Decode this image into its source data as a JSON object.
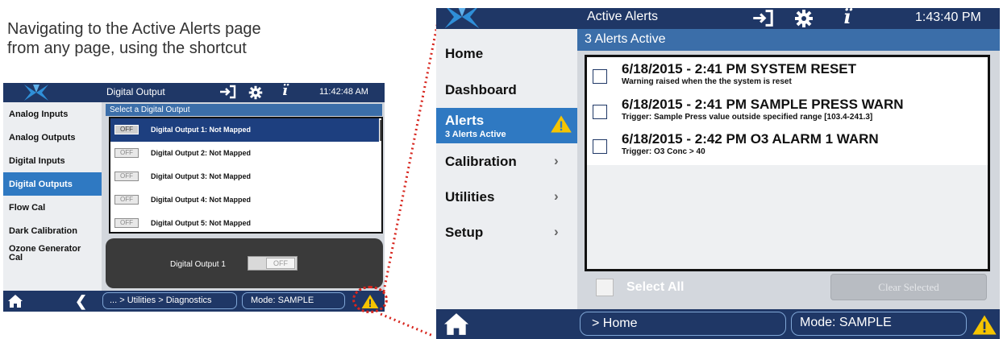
{
  "caption": {
    "line1": "Navigating to the Active Alerts page",
    "line2": "from any page, using the shortcut"
  },
  "colors": {
    "header": "#1f3766",
    "accent": "#2f79c2",
    "warning": "#f5c400",
    "callout": "#d7261e"
  },
  "small_screen": {
    "header": {
      "title": "Digital Output",
      "clock": "11:42:48 AM",
      "icons": [
        "logo-icon",
        "enter-icon",
        "gear-icon",
        "info-icon"
      ]
    },
    "sidebar": [
      {
        "label": "Analog Inputs",
        "active": false
      },
      {
        "label": "Analog Outputs",
        "active": false
      },
      {
        "label": "Digital Inputs",
        "active": false
      },
      {
        "label": "Digital Outputs",
        "active": true
      },
      {
        "label": "Flow Cal",
        "active": false
      },
      {
        "label": "Dark Calibration",
        "active": false
      },
      {
        "label": "Ozone Generator Cal",
        "active": false
      }
    ],
    "subheader": "Select a Digital Output",
    "outputs": [
      {
        "toggle": "OFF",
        "label": "Digital Output 1: Not Mapped",
        "selected": true
      },
      {
        "toggle": "OFF",
        "label": "Digital Output 2: Not Mapped",
        "selected": false
      },
      {
        "toggle": "OFF",
        "label": "Digital Output 3: Not Mapped",
        "selected": false
      },
      {
        "toggle": "OFF",
        "label": "Digital Output 4: Not Mapped",
        "selected": false
      },
      {
        "toggle": "OFF",
        "label": "Digital Output 5: Not Mapped",
        "selected": false
      }
    ],
    "detail": {
      "label": "Digital Output  1",
      "toggle": "OFF"
    },
    "footer": {
      "breadcrumb": "... > Utilities > Diagnostics",
      "mode": "Mode: SAMPLE",
      "icons": [
        "home-icon",
        "back-icon",
        "warning-icon"
      ]
    }
  },
  "big_screen": {
    "header": {
      "title": "Active Alerts",
      "clock": "1:43:40 PM",
      "icons": [
        "logo-icon",
        "enter-icon",
        "gear-icon",
        "info-icon"
      ]
    },
    "sidebar": [
      {
        "label": "Home",
        "sub": "",
        "active": false,
        "chevron": false
      },
      {
        "label": "Dashboard",
        "sub": "",
        "active": false,
        "chevron": false
      },
      {
        "label": "Alerts",
        "sub": "3 Alerts Active",
        "active": true,
        "chevron": false
      },
      {
        "label": "Calibration",
        "sub": "",
        "active": false,
        "chevron": true
      },
      {
        "label": "Utilities",
        "sub": "",
        "active": false,
        "chevron": true
      },
      {
        "label": "Setup",
        "sub": "",
        "active": false,
        "chevron": true
      }
    ],
    "subheader": "3 Alerts Active",
    "alerts": [
      {
        "title": "6/18/2015 - 2:41 PM SYSTEM RESET",
        "desc": "Warning raised when the the system is reset",
        "checked": false
      },
      {
        "title": "6/18/2015 - 2:41 PM SAMPLE PRESS WARN",
        "desc": "Trigger: Sample Press value outside specified range [103.4-241.3]",
        "checked": false
      },
      {
        "title": "6/18/2015 - 2:42 PM O3 ALARM 1 WARN",
        "desc": "Trigger: O3 Conc > 40",
        "checked": false
      }
    ],
    "select_all": "Select All",
    "clear_selected": "Clear Selected",
    "footer": {
      "breadcrumb": "> Home",
      "mode": "Mode: SAMPLE",
      "icons": [
        "home-icon",
        "warning-icon"
      ]
    }
  }
}
